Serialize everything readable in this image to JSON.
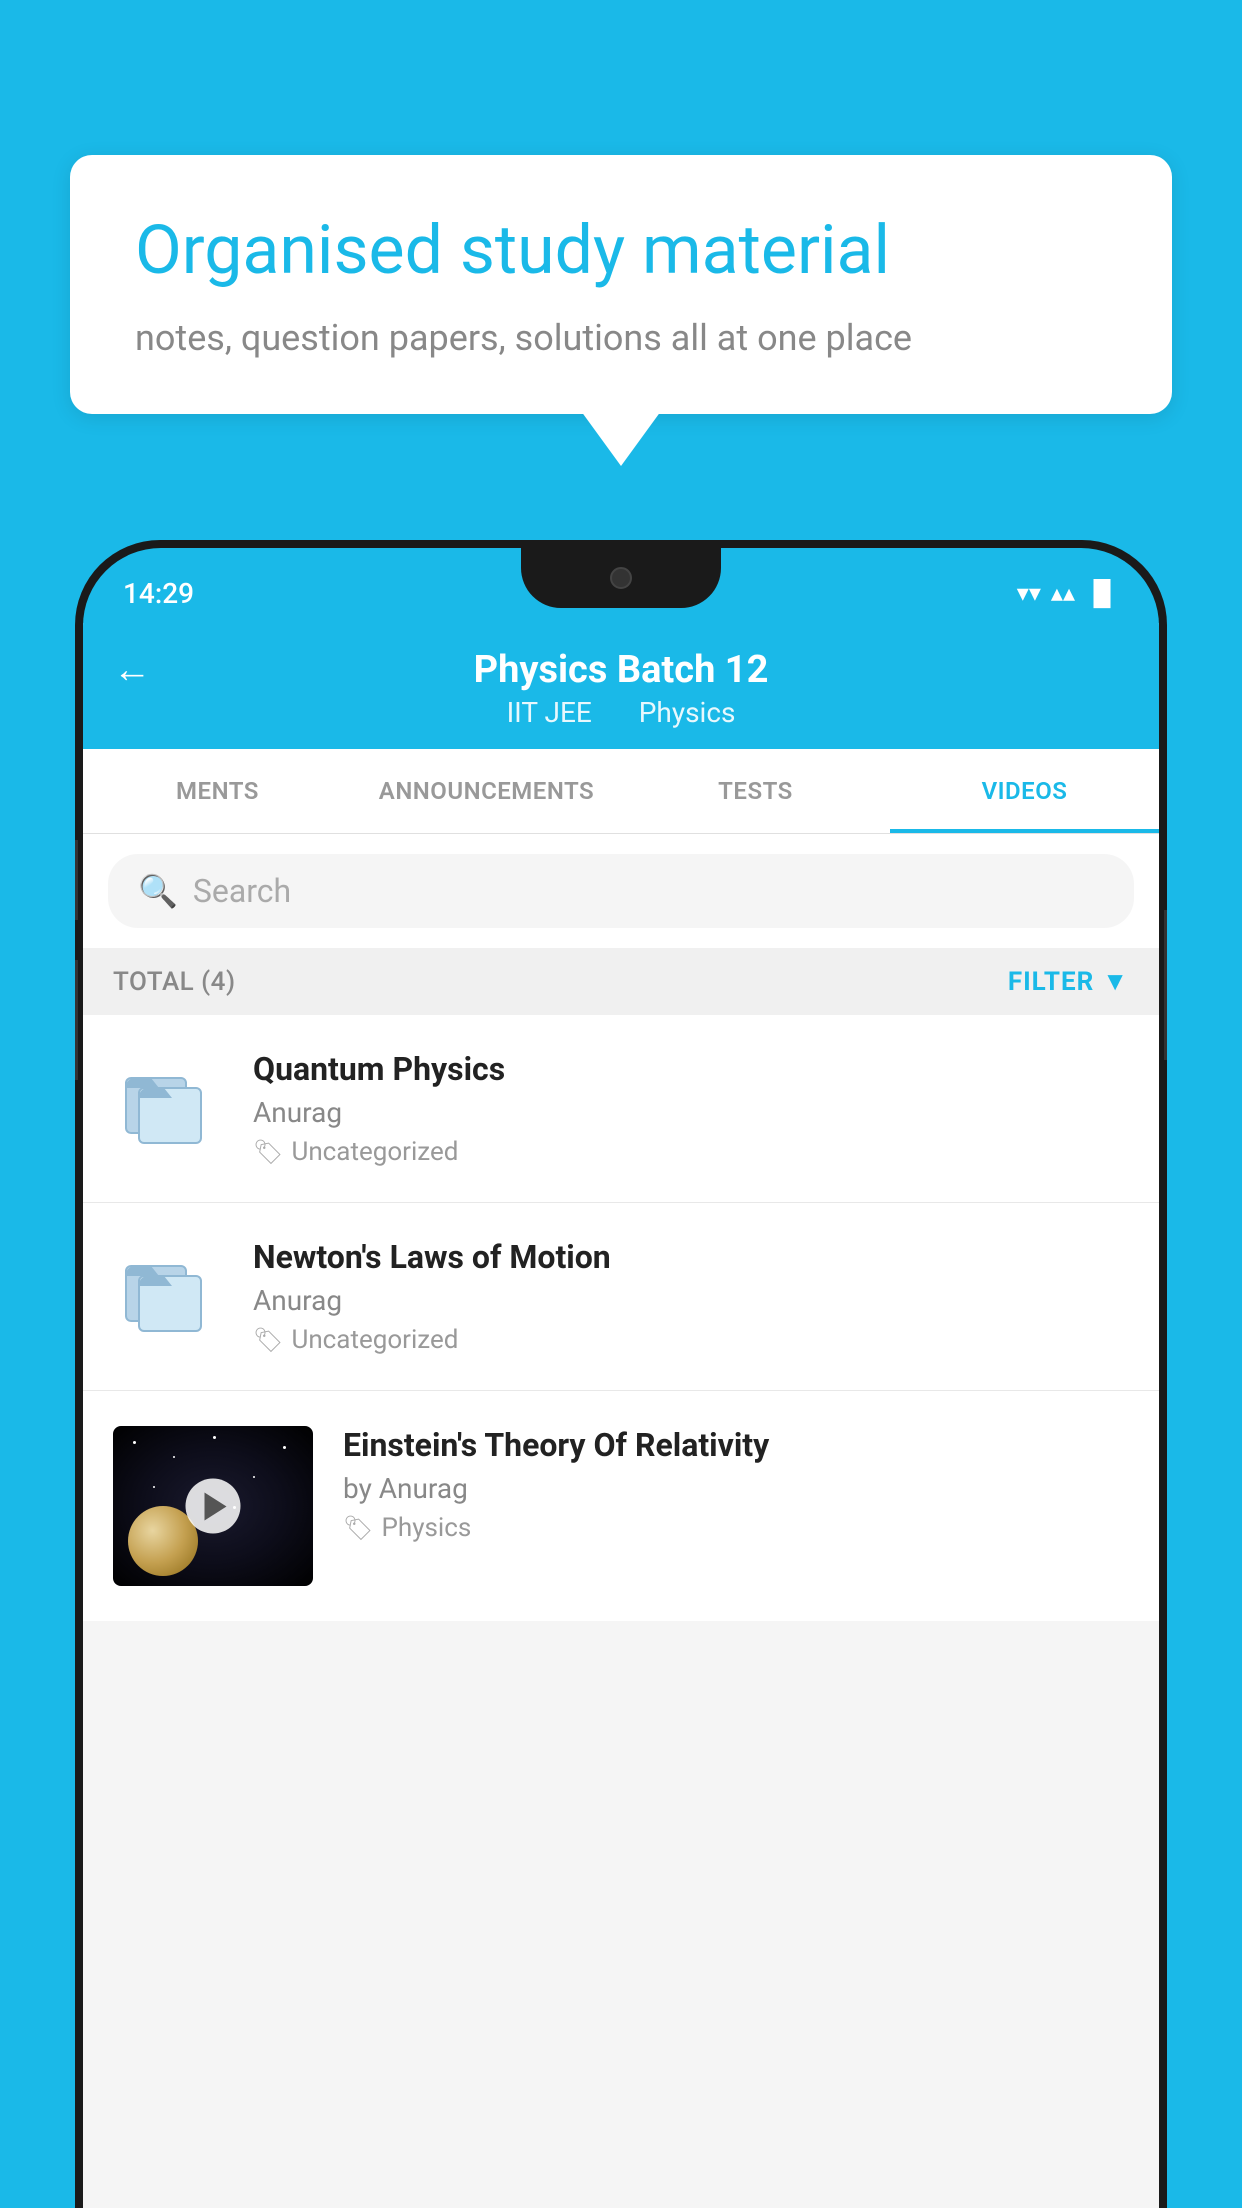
{
  "background_color": "#1ab9e8",
  "speech_bubble": {
    "title": "Organised study material",
    "subtitle": "notes, question papers, solutions all at one place"
  },
  "status_bar": {
    "time": "14:29",
    "wifi_icon": "▾",
    "signal_icon": "▴▴",
    "battery_icon": "▐"
  },
  "header": {
    "back_label": "←",
    "title": "Physics Batch 12",
    "subtitle_part1": "IIT JEE",
    "subtitle_part2": "Physics"
  },
  "tabs": [
    {
      "label": "MENTS",
      "active": false
    },
    {
      "label": "ANNOUNCEMENTS",
      "active": false
    },
    {
      "label": "TESTS",
      "active": false
    },
    {
      "label": "VIDEOS",
      "active": true
    }
  ],
  "search": {
    "placeholder": "Search"
  },
  "filter_row": {
    "total_label": "TOTAL (4)",
    "filter_label": "FILTER"
  },
  "video_items": [
    {
      "title": "Quantum Physics",
      "author": "Anurag",
      "tag": "Uncategorized",
      "has_thumbnail": false
    },
    {
      "title": "Newton's Laws of Motion",
      "author": "Anurag",
      "tag": "Uncategorized",
      "has_thumbnail": false
    },
    {
      "title": "Einstein's Theory Of Relativity",
      "author": "by Anurag",
      "tag": "Physics",
      "has_thumbnail": true
    }
  ]
}
